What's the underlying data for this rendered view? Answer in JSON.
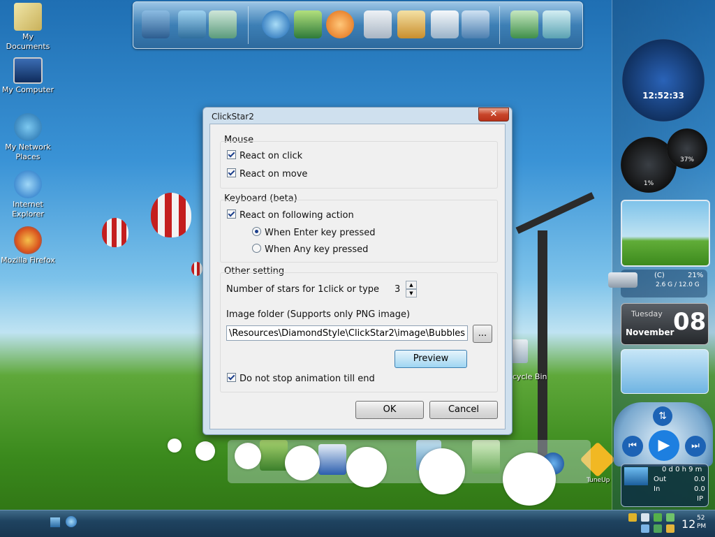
{
  "desktop": {
    "icons": [
      {
        "label": "My Documents",
        "icon": "folder-documents-icon"
      },
      {
        "label": "My Computer",
        "icon": "monitor-icon"
      },
      {
        "label": "My Network Places",
        "icon": "network-icon"
      },
      {
        "label": "Internet Explorer",
        "icon": "ie-icon"
      },
      {
        "label": "Mozilla Firefox",
        "icon": "firefox-icon"
      }
    ],
    "recycle_bin_label": "cycle Bin",
    "tuneup_label": "TuneUp"
  },
  "sidebar": {
    "clock_time": "12:52:33",
    "cpu_percent": "1%",
    "mem_percent": "37%",
    "drive": {
      "letter": "(C)",
      "percent": "21%",
      "usage": "2.6 G / 12.0 G"
    },
    "calendar": {
      "weekday": "Tuesday",
      "day": "08",
      "month": "November"
    },
    "network": {
      "uptime": "0 d 0 h 9 m",
      "out_label": "Out",
      "out_value": "0.0",
      "in_label": "In",
      "in_value": "0.0",
      "ip_label": "IP"
    }
  },
  "dialog": {
    "title": "ClickStar2",
    "close_glyph": "✕",
    "mouse": {
      "label": "Mouse",
      "react_on_click": "React on click",
      "react_on_move": "React on move"
    },
    "keyboard": {
      "label": "Keyboard (beta)",
      "react_on_action": "React on following action",
      "enter_key": "When Enter key pressed",
      "any_key": "When Any key pressed"
    },
    "other": {
      "label": "Other setting",
      "stars_label": "Number of stars for 1click or type",
      "stars_value": "3",
      "folder_label": "Image folder (Supports only PNG image)",
      "folder_value": "\\Resources\\DiamondStyle\\ClickStar2\\image\\Bubbles",
      "browse_label": "...",
      "preview_label": "Preview",
      "no_stop_label": "Do not stop animation till end"
    },
    "ok_label": "OK",
    "cancel_label": "Cancel"
  },
  "taskbar": {
    "time_hour": "12",
    "time_min": "52",
    "time_ampm": "PM"
  }
}
